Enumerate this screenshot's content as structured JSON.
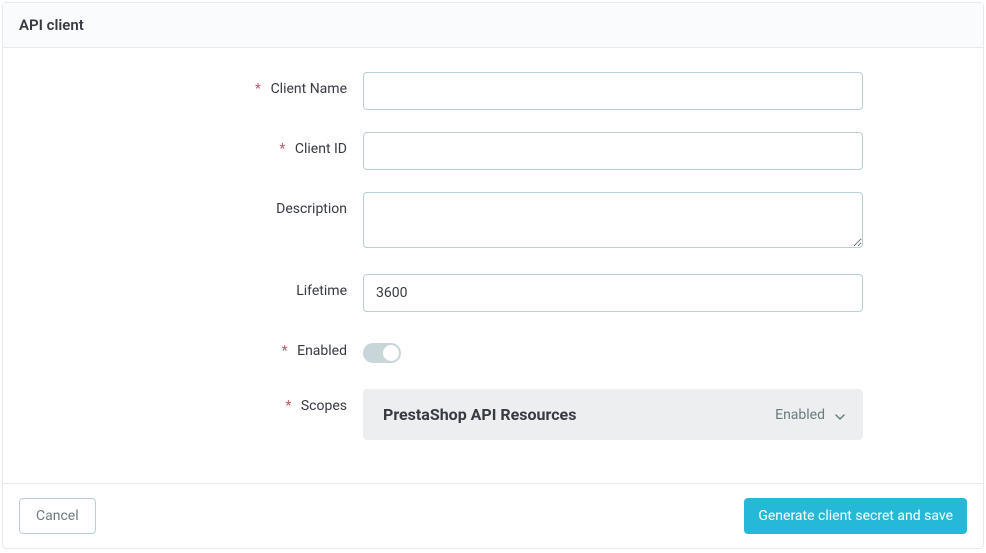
{
  "header": {
    "title": "API client"
  },
  "form": {
    "clientName": {
      "label": "Client Name",
      "value": "",
      "required": true
    },
    "clientId": {
      "label": "Client ID",
      "value": "",
      "required": true
    },
    "description": {
      "label": "Description",
      "value": "",
      "required": false
    },
    "lifetime": {
      "label": "Lifetime",
      "value": "3600",
      "required": false
    },
    "enabled": {
      "label": "Enabled",
      "value": true,
      "required": true
    },
    "scopes": {
      "label": "Scopes",
      "required": true,
      "panelTitle": "PrestaShop API Resources",
      "panelStatus": "Enabled"
    }
  },
  "footer": {
    "cancel": "Cancel",
    "save": "Generate client secret and save"
  },
  "requiredMark": "*"
}
